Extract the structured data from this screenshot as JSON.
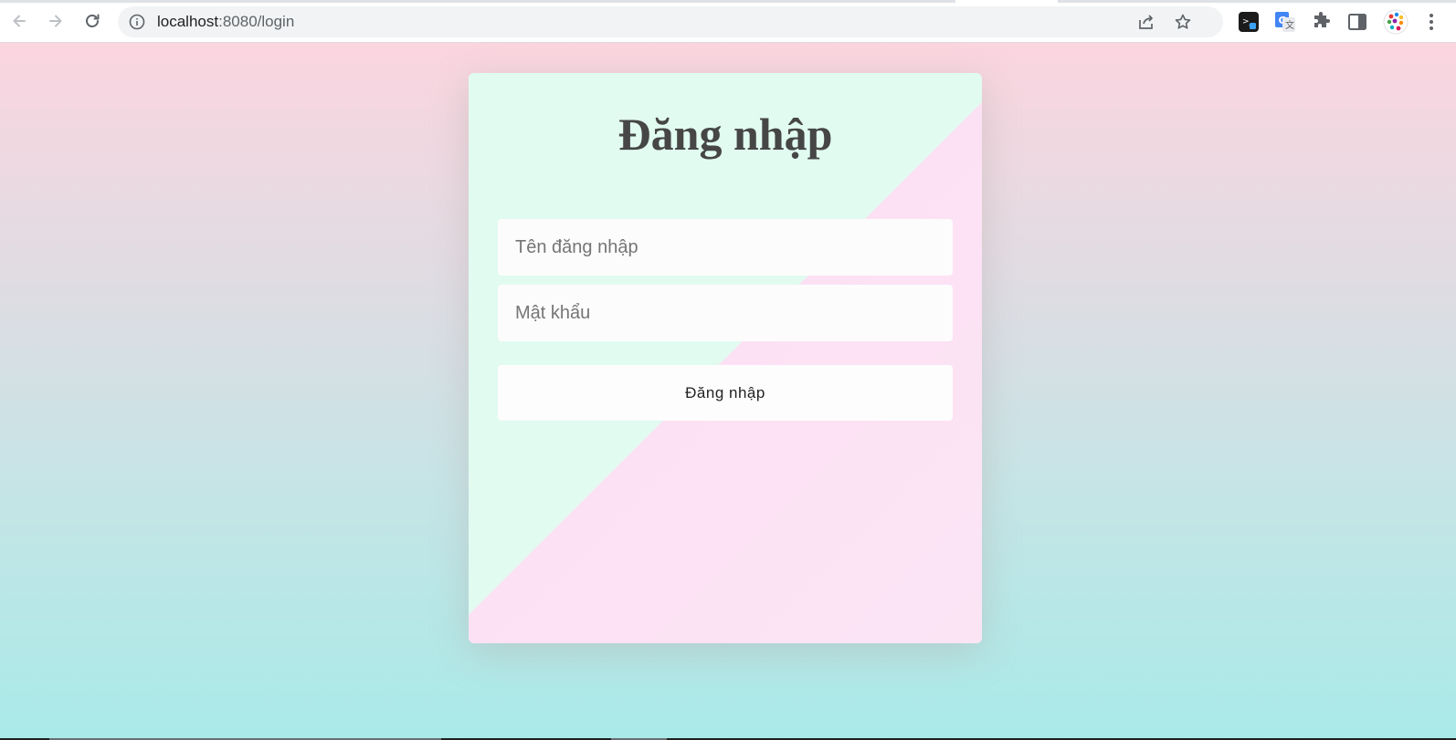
{
  "browser": {
    "url_host": "localhost",
    "url_path": ":8080/login"
  },
  "login": {
    "title": "Đăng nhập",
    "username_placeholder": "Tên đăng nhập",
    "password_placeholder": "Mật khẩu",
    "submit_label": "Đăng nhập"
  },
  "colors": {
    "card_top_left": "#e1fbf0",
    "card_bottom_right": "#fce1f4",
    "page_top": "#fbd5df",
    "page_bottom": "#a9eae8",
    "title_text": "#464646"
  },
  "icons": {
    "back": "arrow-left",
    "forward": "arrow-right",
    "reload": "reload",
    "site_info": "info-circle",
    "share": "share",
    "bookmark": "star-outline",
    "extensions": "puzzle-piece",
    "side_panel": "side-panel",
    "menu": "kebab-menu"
  }
}
